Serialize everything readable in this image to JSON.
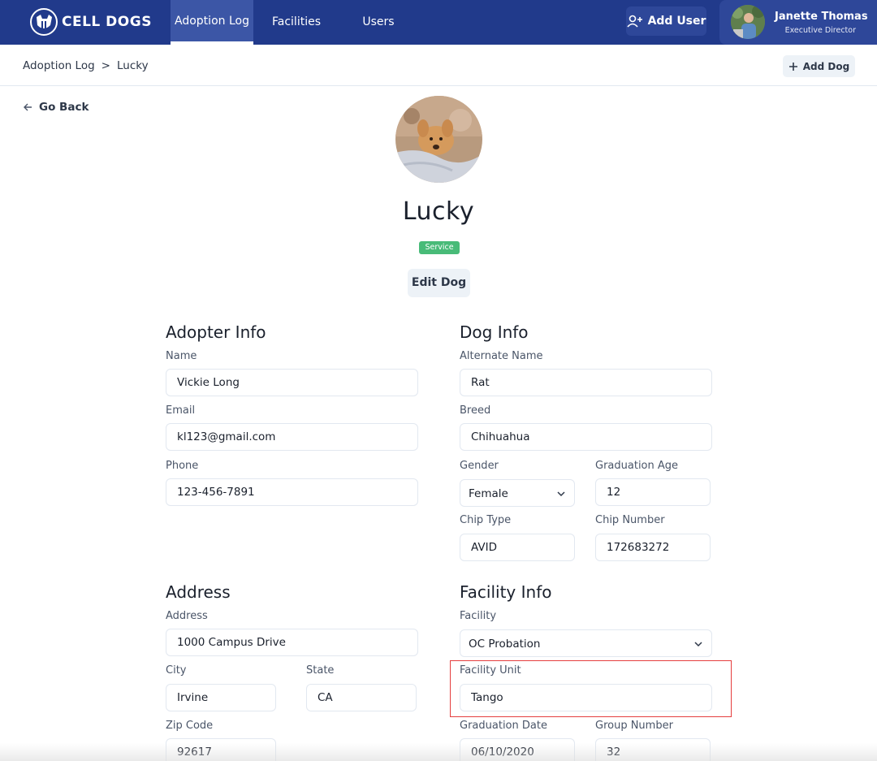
{
  "brand": {
    "name": "CELL DOGS"
  },
  "nav": {
    "tabs": [
      {
        "label": "Adoption Log"
      },
      {
        "label": "Facilities"
      },
      {
        "label": "Users"
      }
    ],
    "add_user_label": "Add User"
  },
  "user": {
    "name": "Janette Thomas",
    "role": "Executive Director"
  },
  "breadcrumb": {
    "parent": "Adoption Log",
    "separator": ">",
    "current": "Lucky"
  },
  "add_dog_label": "Add Dog",
  "go_back_label": "Go Back",
  "dog": {
    "name": "Lucky",
    "badge": "Service",
    "edit_label": "Edit Dog"
  },
  "adopter_info": {
    "title": "Adopter Info",
    "name_label": "Name",
    "name_value": "Vickie Long",
    "email_label": "Email",
    "email_value": "kl123@gmail.com",
    "phone_label": "Phone",
    "phone_value": "123-456-7891"
  },
  "dog_info": {
    "title": "Dog Info",
    "alt_name_label": "Alternate Name",
    "alt_name_value": "Rat",
    "breed_label": "Breed",
    "breed_value": "Chihuahua",
    "gender_label": "Gender",
    "gender_value": "Female",
    "grad_age_label": "Graduation Age",
    "grad_age_value": "12",
    "chip_type_label": "Chip Type",
    "chip_type_value": "AVID",
    "chip_number_label": "Chip Number",
    "chip_number_value": "172683272"
  },
  "address": {
    "title": "Address",
    "address_label": "Address",
    "address_value": "1000 Campus Drive",
    "city_label": "City",
    "city_value": "Irvine",
    "state_label": "State",
    "state_value": "CA",
    "zip_label": "Zip Code",
    "zip_value": "92617"
  },
  "facility_info": {
    "title": "Facility Info",
    "facility_label": "Facility",
    "facility_value": "OC Probation",
    "unit_label": "Facility Unit",
    "unit_value": "Tango",
    "grad_date_label": "Graduation Date",
    "grad_date_value": "06/10/2020",
    "group_label": "Group Number",
    "group_value": "32"
  },
  "colors": {
    "navbar": "#213a8b",
    "badge": "#48bb78",
    "highlight": "#e53e3e"
  }
}
